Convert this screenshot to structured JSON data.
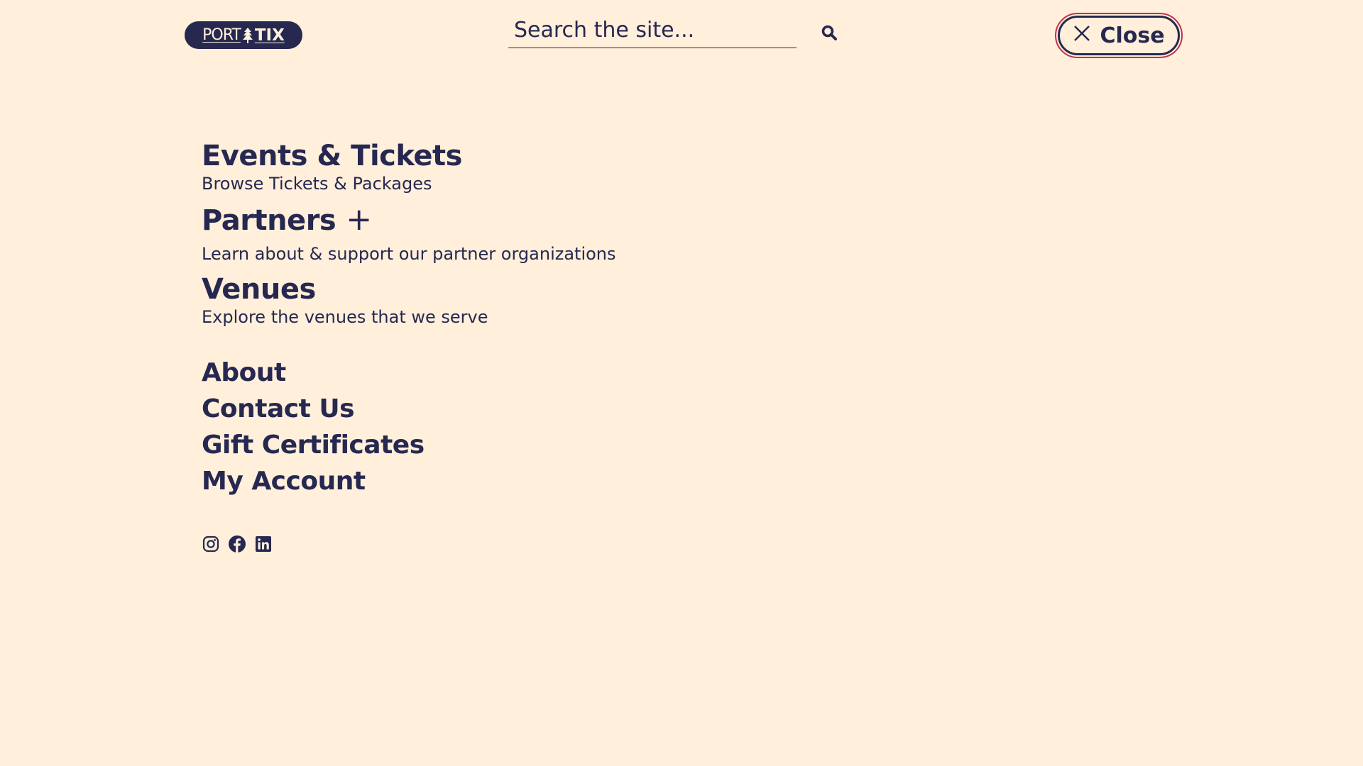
{
  "header": {
    "logo": {
      "part1": "PORT",
      "part2": "TIX"
    },
    "search": {
      "placeholder": "Search the site..."
    },
    "close_label": "Close"
  },
  "menu": {
    "primary": [
      {
        "title": "Events & Tickets",
        "description": "Browse Tickets & Packages"
      },
      {
        "title": "Partners",
        "expand_symbol": "+",
        "description": "Learn about & support our partner organizations"
      },
      {
        "title": "Venues",
        "description": "Explore the venues that we serve"
      }
    ],
    "secondary": [
      "About",
      "Contact Us",
      "Gift Certificates",
      "My Account"
    ]
  },
  "social": [
    "instagram-icon",
    "facebook-icon",
    "linkedin-icon"
  ],
  "colors": {
    "background": "#FFEFDB",
    "text": "#262850",
    "focus_ring": "#C62F4C"
  }
}
